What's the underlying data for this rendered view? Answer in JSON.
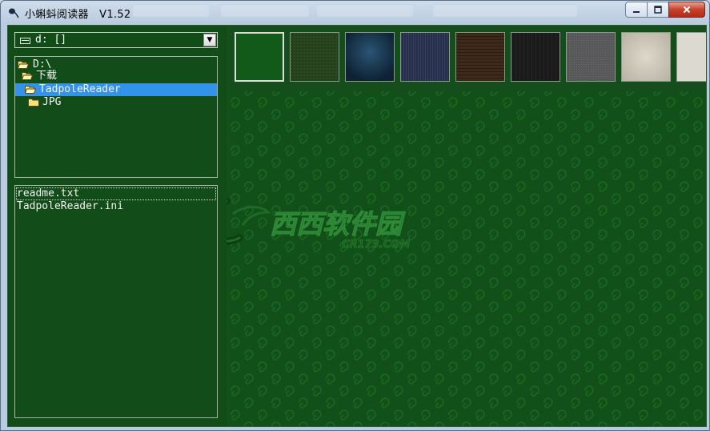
{
  "window": {
    "title": "小蝌蚪阅读器",
    "version": "V1.52"
  },
  "drive": {
    "selected": "d: []"
  },
  "tree": [
    {
      "label": "D:\\",
      "icon": "open-folder-icon"
    },
    {
      "label": "下载",
      "icon": "open-folder-icon"
    },
    {
      "label": "TadpoleReader",
      "icon": "open-folder-icon",
      "selected": true
    },
    {
      "label": "JPG",
      "icon": "folder-icon"
    }
  ],
  "files": [
    {
      "name": "readme.txt",
      "focused": true
    },
    {
      "name": "TadpoleReader.ini",
      "focused": false
    }
  ],
  "backgrounds": [
    {
      "name": "green-pattern",
      "color": "#125a1a",
      "selected": true
    },
    {
      "name": "dark-green-fabric",
      "color": "#24401c"
    },
    {
      "name": "dark-blue",
      "color": "#14314a"
    },
    {
      "name": "blue-denim",
      "color": "#252f4a"
    },
    {
      "name": "brown-wood",
      "color": "#3e2a1a"
    },
    {
      "name": "black-wood",
      "color": "#1a1a1a"
    },
    {
      "name": "gray-fabric",
      "color": "#58585a"
    },
    {
      "name": "beige-paper",
      "color": "#c9c4b5"
    },
    {
      "name": "light-paper",
      "color": "#dcdad0"
    }
  ],
  "watermark": {
    "brand": "西西软件园",
    "site": "CR173.COM"
  },
  "colors": {
    "reading_bg": "#115018",
    "selection": "#3393ea"
  }
}
